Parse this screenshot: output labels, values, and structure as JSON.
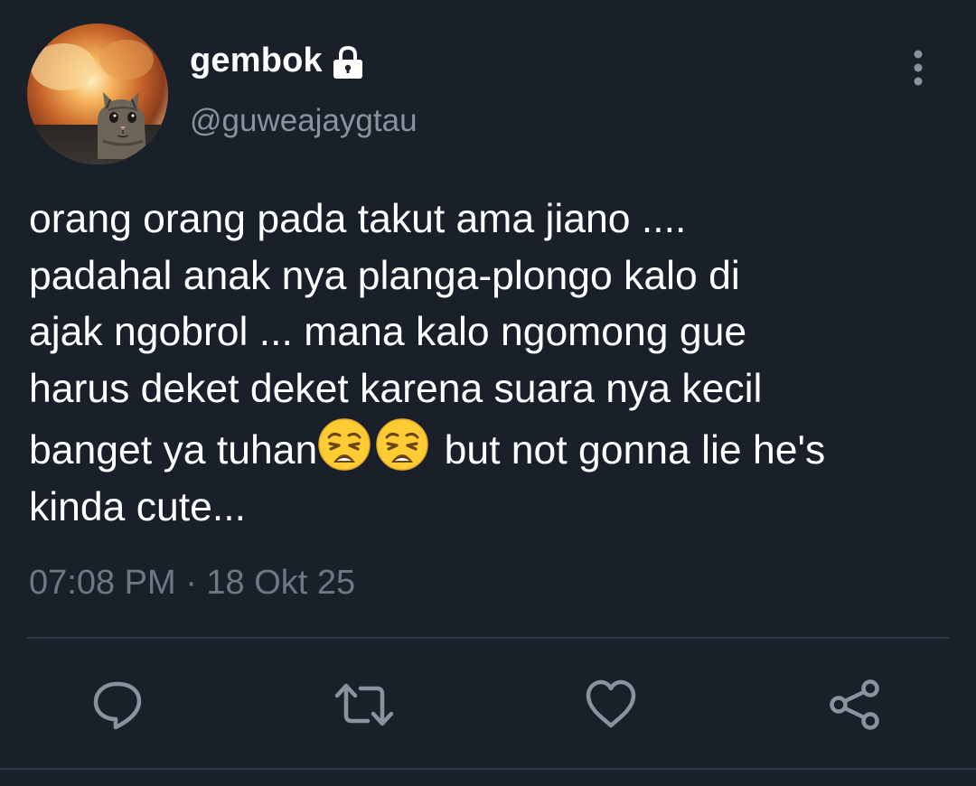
{
  "tweet": {
    "author": {
      "display_name": "gembok",
      "handle": "@guweajaygtau",
      "protected_icon": "lock-icon",
      "avatar": "cat-photo-avatar"
    },
    "text_before_emoji": "orang orang pada takut ama jiano ....\npadahal anak nya planga-plongo kalo di\najak ngobrol ... mana kalo ngomong gue\nharus deket deket karena suara nya kecil\nbanget ya tuhan",
    "emojis": [
      "weary-face-emoji",
      "weary-face-emoji"
    ],
    "text_after_emoji": " but not gonna lie he's\nkinda cute...",
    "timestamp": "07:08 PM · 18 Okt 25"
  },
  "actions": {
    "more": "more-vertical-icon",
    "reply": "reply-icon",
    "retweet": "retweet-icon",
    "like": "heart-icon",
    "share": "share-icon"
  },
  "colors": {
    "background": "#1a2029",
    "primary_text": "#ffffff",
    "secondary_text": "#8a939d",
    "icon": "#8a939d",
    "divider": "#2e3742"
  }
}
